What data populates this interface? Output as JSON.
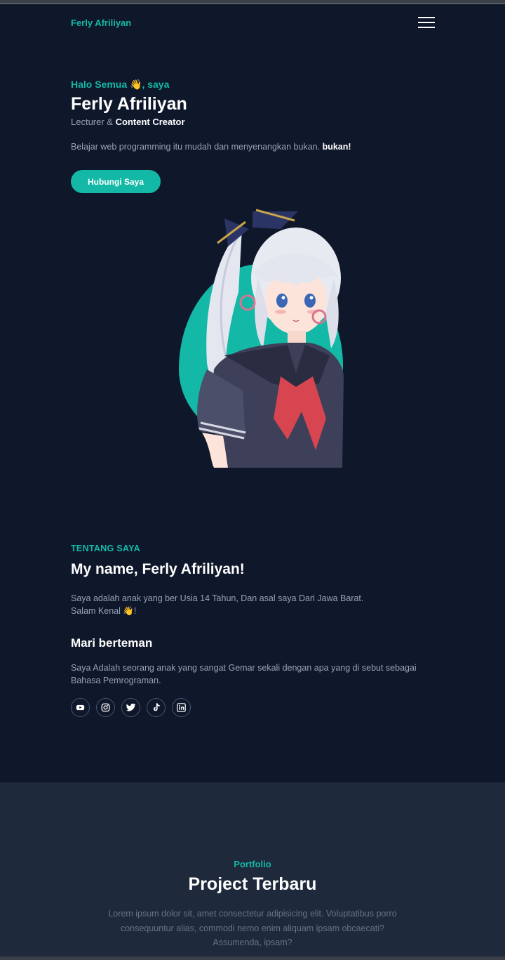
{
  "navbar": {
    "brand": "Ferly Afriliyan",
    "menu_icon": "hamburger-menu-icon"
  },
  "hero": {
    "greeting": "Halo Semua 👋, saya",
    "name": "Ferly Afriliyan",
    "role_prefix": "Lecturer &",
    "role_highlight": "Content Creator",
    "description": "Belajar web programming itu mudah dan menyenangkan bukan.",
    "description_bold": "bukan!",
    "button_label": "Hubungi Saya",
    "image_alt": "anime-girl-portrait",
    "accent_color": "#14b8a6"
  },
  "about": {
    "kicker": "TENTANG SAYA",
    "title": "My name, Ferly Afriliyan!",
    "text_line1": "Saya adalah anak yang ber Usia 14 Tahun, Dan asal saya Dari Jawa Barat.",
    "text_line2": "Salam Kenal 👋!",
    "subtitle": "Mari berteman",
    "text2": "Saya Adalah seorang anak yang sangat Gemar sekali dengan apa yang di sebut sebagai Bahasa Pemrograman.",
    "socials": [
      "youtube-icon",
      "instagram-icon",
      "twitter-icon",
      "tiktok-icon",
      "linkedin-icon"
    ]
  },
  "portfolio": {
    "kicker": "Portfolio",
    "title": "Project Terbaru",
    "description": "Lorem ipsum dolor sit, amet consectetur adipisicing elit. Voluptatibus porro consequuntur alias, commodi nemo enim aliquam ipsam obcaecati? Assumenda, ipsam?"
  },
  "colors": {
    "background": "#0f172a",
    "section_alt": "#1e293b",
    "accent": "#14b8a6",
    "muted": "#94a3b8"
  }
}
